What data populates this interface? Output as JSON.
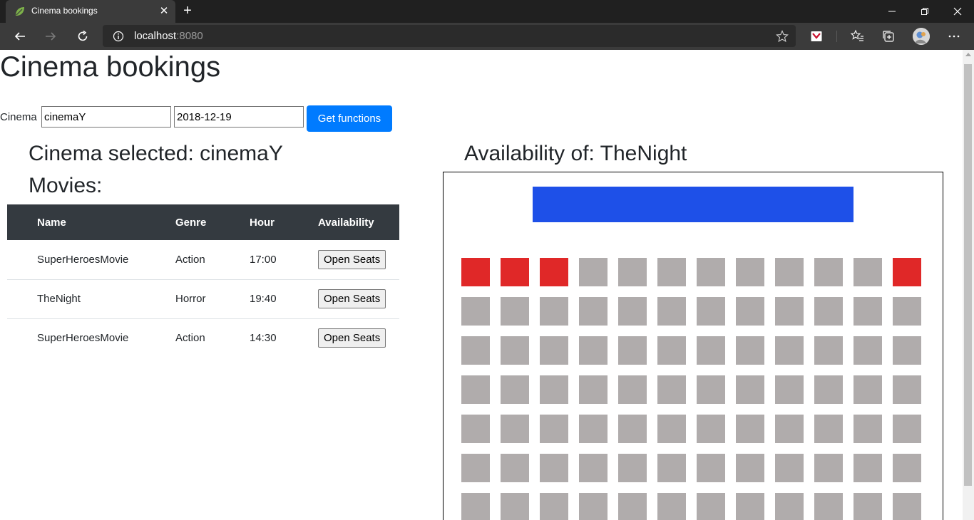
{
  "browser": {
    "tab_title": "Cinema bookings",
    "url_host": "localhost",
    "url_port": ":8080"
  },
  "page": {
    "title": "Cinema bookings",
    "cinema_label": "Cinema",
    "cinema_value": "cinemaY",
    "date_value": "2018-12-19",
    "get_functions_label": "Get functions",
    "selected_heading": "Cinema selected: cinemaY",
    "movies_heading": "Movies:",
    "availability_heading": "Availability of: TheNight"
  },
  "table": {
    "headers": [
      "Name",
      "Genre",
      "Hour",
      "Availability"
    ],
    "rows": [
      {
        "name": "SuperHeroesMovie",
        "genre": "Action",
        "hour": "17:00",
        "button": "Open Seats"
      },
      {
        "name": "TheNight",
        "genre": "Horror",
        "hour": "19:40",
        "button": "Open Seats"
      },
      {
        "name": "SuperHeroesMovie",
        "genre": "Action",
        "hour": "14:30",
        "button": "Open Seats"
      }
    ]
  },
  "seats": {
    "columns": 12,
    "rows_visible": 7,
    "taken_row0": [
      0,
      1,
      2,
      11
    ],
    "colors": {
      "taken": "#e02828",
      "free": "#b0acac",
      "screen": "#1e50e8"
    }
  },
  "colors": {
    "primary": "#007bff",
    "table_header": "#343a40",
    "chrome_dark": "#202020",
    "chrome_toolbar": "#3b3b3b"
  }
}
